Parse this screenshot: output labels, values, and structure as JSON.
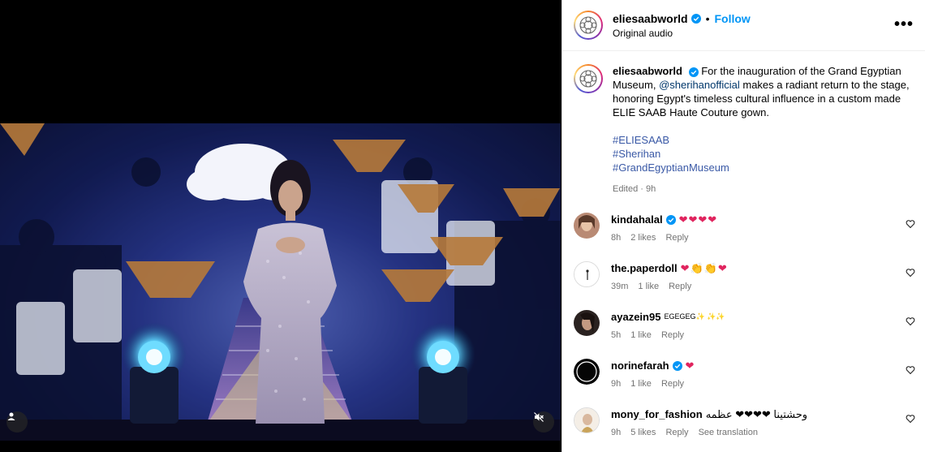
{
  "post": {
    "username": "eliesaabworld",
    "follow_label": "Follow",
    "audio_label": "Original audio",
    "more_label": "•••",
    "caption": {
      "text_before": "For the inauguration of the Grand Egyptian Museum, ",
      "mention": "@sherihanofficial",
      "text_after": " makes a radiant return to the stage, honoring Egypt's timeless cultural influence in a custom made ELIE SAAB Haute Couture gown.",
      "hashtags": [
        "#ELIESAAB",
        "#Sherihan",
        "#GrandEgyptianMuseum"
      ],
      "edited": "Edited · 9h"
    }
  },
  "comments": [
    {
      "user": "kindahalal",
      "verified": true,
      "text": "❤❤❤❤",
      "time": "8h",
      "likes": "2 likes",
      "reply": "Reply",
      "translate": ""
    },
    {
      "user": "the.paperdoll",
      "verified": false,
      "text": "❤👏👏❤",
      "time": "39m",
      "likes": "1 like",
      "reply": "Reply",
      "translate": ""
    },
    {
      "user": "ayazein95",
      "verified": false,
      "text": "EGEGEG✨ ✨✨",
      "time": "5h",
      "likes": "1 like",
      "reply": "Reply",
      "translate": ""
    },
    {
      "user": "norinefarah",
      "verified": true,
      "text": "❤",
      "time": "9h",
      "likes": "1 like",
      "reply": "Reply",
      "translate": ""
    },
    {
      "user": "mony_for_fashion",
      "verified": false,
      "text": "وحشتينا ❤❤❤❤ عظمه",
      "time": "9h",
      "likes": "5 likes",
      "reply": "Reply",
      "translate": "See translation"
    }
  ],
  "colors": {
    "link": "#0095f6",
    "hashtag": "#3a59a6",
    "heart": "#e0245e",
    "meta": "#737373"
  },
  "icons": {
    "verified": "verified-badge-icon",
    "user_tag": "user-icon",
    "mute": "speaker-muted-icon",
    "like": "heart-outline-icon"
  }
}
